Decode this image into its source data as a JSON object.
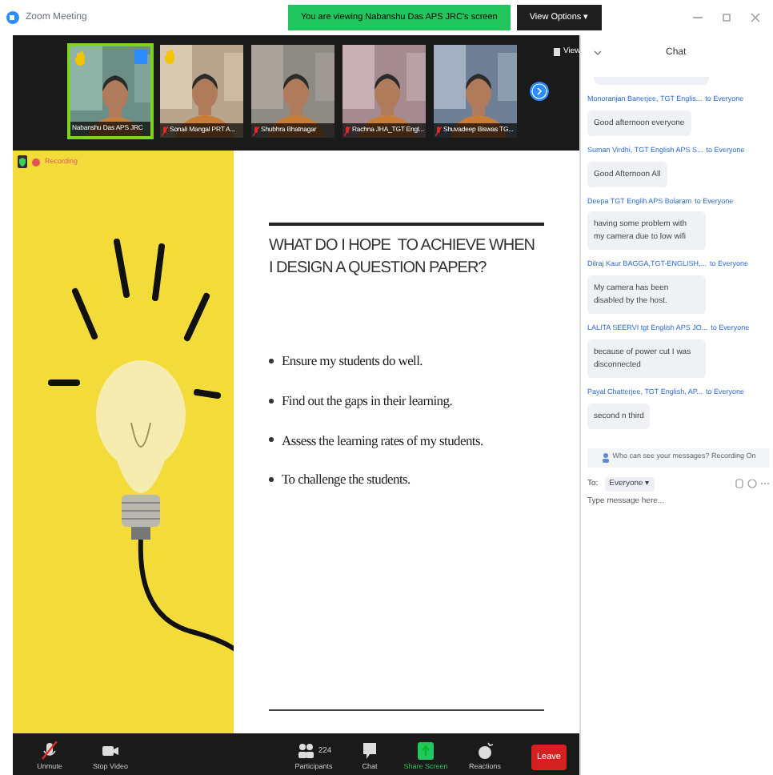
{
  "window": {
    "title": "Zoom Meeting"
  },
  "banner": {
    "text": "You are viewing Nabanshu Das APS JRC's screen",
    "button": "View Options ▾"
  },
  "videos": [
    {
      "name": "Nabanshu Das APS JRC",
      "speaking": true,
      "muted": false,
      "hand_raised": true,
      "menu": true,
      "kind": "picture"
    },
    {
      "name": "Sonali Mangal PRT A...",
      "speaking": false,
      "muted": true,
      "hand_raised": true,
      "menu": false,
      "kind": "picture"
    },
    {
      "name": "Shubhra Bhatnagar",
      "speaking": false,
      "muted": true,
      "hand_raised": false,
      "menu": false,
      "kind": "picture"
    },
    {
      "name": "Rachna JHA_TGT Engl...",
      "speaking": false,
      "muted": true,
      "hand_raised": false,
      "menu": false,
      "kind": "picture"
    },
    {
      "name": "Shuvadeep Biswas TG...",
      "speaking": false,
      "muted": true,
      "hand_raised": false,
      "menu": false,
      "kind": "picture"
    }
  ],
  "view_button": "View",
  "recording": {
    "label": "Recording"
  },
  "slide": {
    "title_lines": [
      "WHAT DO I HOPE  TO ACHIEVE WHEN",
      "I DESIGN A QUESTION PAPER?"
    ],
    "bullets": [
      "Ensure my students do well.",
      "Find out the gaps in their learning.",
      "Assess the learning rates of my students.",
      "To challenge the students."
    ]
  },
  "toolbar": [
    {
      "kind": "mic",
      "label": "Unmute",
      "muted": true
    },
    {
      "kind": "video",
      "label": "Stop Video"
    },
    {
      "kind": "participants",
      "label": "Participants",
      "count": "224"
    },
    {
      "kind": "chat",
      "label": "Chat"
    },
    {
      "kind": "share",
      "label": "Share Screen"
    },
    {
      "kind": "reactions",
      "label": "Reactions"
    }
  ],
  "leave_button": "Leave",
  "chat": {
    "title": "Chat",
    "messages": [
      {
        "sender": "Monoranjan Banerjee, TGT Englis...",
        "to": "to Everyone",
        "text": "Good afternoon everyone"
      },
      {
        "sender": "Suman Virdhi, TGT English APS S...",
        "to": "to Everyone",
        "text": "Good Afternoon All"
      },
      {
        "sender": "Deepa TGT Englih APS Bolaram",
        "to": "to Everyone",
        "text": "having some problem with my camera due to low wifi"
      },
      {
        "sender": "Dilraj Kaur BAGGA,TGT-ENGLISH,...",
        "to": "to Everyone",
        "text": "My camera has been disabled by the host."
      },
      {
        "sender": "LALITA SEERVI tgt English APS JO...",
        "to": "to Everyone",
        "text": "because of power cut I was disconnected"
      },
      {
        "sender": "Payal Chatterjee, TGT English, AP...",
        "to": "to Everyone",
        "text": "second n third"
      }
    ],
    "notice": "Who can see your messages? Recording On",
    "to_label": "To:",
    "recipient": "Everyone ▾",
    "placeholder": "Type message here..."
  }
}
